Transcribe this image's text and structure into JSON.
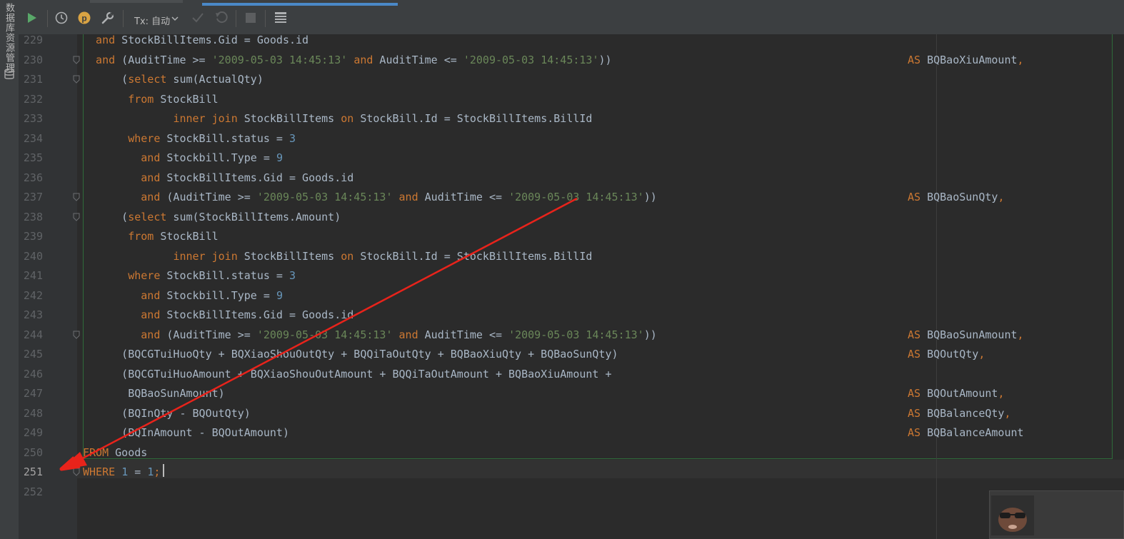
{
  "sidebar": {
    "label": "数据库资源管理"
  },
  "toolbar": {
    "tx_label": "Tx: 自动"
  },
  "icons": {
    "run": "run-icon",
    "history": "clock-icon",
    "profile": "p-icon",
    "settings": "wrench-icon",
    "commit": "check-icon",
    "rollback": "undo-icon",
    "stop": "stop-icon",
    "output": "table-icon",
    "database": "database-icon",
    "avatar": "avatar-icon"
  },
  "colors": {
    "keyword": "#cc7832",
    "string": "#6a8759",
    "number": "#6897bb",
    "text": "#a9b7c6",
    "annotation": "#e8231b"
  },
  "editor": {
    "current_line": "251",
    "lines": [
      {
        "num": "229",
        "segs": [
          {
            "t": "  and",
            "c": "kw"
          },
          {
            "t": " StockBillItems.Gid = Goods.id"
          }
        ]
      },
      {
        "num": "230",
        "segs": [
          {
            "t": "  and",
            "c": "kw"
          },
          {
            "t": " (AuditTime >= "
          },
          {
            "t": "'2009-05-03 14:45:13'",
            "c": "str"
          },
          {
            "t": " "
          },
          {
            "t": "and",
            "c": "kw"
          },
          {
            "t": " AuditTime <= "
          },
          {
            "t": "'2009-05-03 14:45:13'",
            "c": "str"
          },
          {
            "t": "))"
          }
        ],
        "as_segs": [
          {
            "t": "AS",
            "c": "kw"
          },
          {
            "t": " BQBaoXiuAmount"
          },
          {
            "t": ",",
            "c": "kw"
          }
        ]
      },
      {
        "num": "231",
        "segs": [
          {
            "t": "      ("
          },
          {
            "t": "select",
            "c": "kw"
          },
          {
            "t": " sum(ActualQty)"
          }
        ]
      },
      {
        "num": "232",
        "segs": [
          {
            "t": "       from",
            "c": "kw"
          },
          {
            "t": " StockBill"
          }
        ]
      },
      {
        "num": "233",
        "segs": [
          {
            "t": "              "
          },
          {
            "t": "inner join",
            "c": "kw"
          },
          {
            "t": " StockBillItems "
          },
          {
            "t": "on",
            "c": "kw"
          },
          {
            "t": " StockBill.Id = StockBillItems.BillId"
          }
        ]
      },
      {
        "num": "234",
        "segs": [
          {
            "t": "       where",
            "c": "kw"
          },
          {
            "t": " StockBill.status = "
          },
          {
            "t": "3",
            "c": "num"
          }
        ]
      },
      {
        "num": "235",
        "segs": [
          {
            "t": "         and",
            "c": "kw"
          },
          {
            "t": " Stockbill.Type = "
          },
          {
            "t": "9",
            "c": "num"
          }
        ]
      },
      {
        "num": "236",
        "segs": [
          {
            "t": "         and",
            "c": "kw"
          },
          {
            "t": " StockBillItems.Gid = Goods.id"
          }
        ]
      },
      {
        "num": "237",
        "segs": [
          {
            "t": "         and",
            "c": "kw"
          },
          {
            "t": " (AuditTime >= "
          },
          {
            "t": "'2009-05-03 14:45:13'",
            "c": "str"
          },
          {
            "t": " "
          },
          {
            "t": "and",
            "c": "kw"
          },
          {
            "t": " AuditTime <= "
          },
          {
            "t": "'2009-05-03 14:45:13'",
            "c": "str"
          },
          {
            "t": "))"
          }
        ],
        "as_segs": [
          {
            "t": "AS",
            "c": "kw"
          },
          {
            "t": " BQBaoSunQty"
          },
          {
            "t": ",",
            "c": "kw"
          }
        ]
      },
      {
        "num": "238",
        "segs": [
          {
            "t": "      ("
          },
          {
            "t": "select",
            "c": "kw"
          },
          {
            "t": " sum(StockBillItems.Amount)"
          }
        ]
      },
      {
        "num": "239",
        "segs": [
          {
            "t": "       from",
            "c": "kw"
          },
          {
            "t": " StockBill"
          }
        ]
      },
      {
        "num": "240",
        "segs": [
          {
            "t": "              "
          },
          {
            "t": "inner join",
            "c": "kw"
          },
          {
            "t": " StockBillItems "
          },
          {
            "t": "on",
            "c": "kw"
          },
          {
            "t": " StockBill.Id = StockBillItems.BillId"
          }
        ]
      },
      {
        "num": "241",
        "segs": [
          {
            "t": "       where",
            "c": "kw"
          },
          {
            "t": " StockBill.status = "
          },
          {
            "t": "3",
            "c": "num"
          }
        ]
      },
      {
        "num": "242",
        "segs": [
          {
            "t": "         and",
            "c": "kw"
          },
          {
            "t": " Stockbill.Type = "
          },
          {
            "t": "9",
            "c": "num"
          }
        ]
      },
      {
        "num": "243",
        "segs": [
          {
            "t": "         and",
            "c": "kw"
          },
          {
            "t": " StockBillItems.Gid = Goods.id"
          }
        ]
      },
      {
        "num": "244",
        "segs": [
          {
            "t": "         and",
            "c": "kw"
          },
          {
            "t": " (AuditTime >= "
          },
          {
            "t": "'2009-05-03 14:45:13'",
            "c": "str"
          },
          {
            "t": " "
          },
          {
            "t": "and",
            "c": "kw"
          },
          {
            "t": " AuditTime <= "
          },
          {
            "t": "'2009-05-03 14:45:13'",
            "c": "str"
          },
          {
            "t": "))"
          }
        ],
        "as_segs": [
          {
            "t": "AS",
            "c": "kw"
          },
          {
            "t": " BQBaoSunAmount"
          },
          {
            "t": ",",
            "c": "kw"
          }
        ]
      },
      {
        "num": "245",
        "segs": [
          {
            "t": "      (BQCGTuiHuoQty + BQXiaoShouOutQty + BQQiTaOutQty + BQBaoXiuQty + BQBaoSunQty)"
          }
        ],
        "as_segs": [
          {
            "t": "AS",
            "c": "kw"
          },
          {
            "t": " BQOutQty"
          },
          {
            "t": ",",
            "c": "kw"
          }
        ]
      },
      {
        "num": "246",
        "segs": [
          {
            "t": "      (BQCGTuiHuoAmount + BQXiaoShouOutAmount + BQQiTaOutAmount + BQBaoXiuAmount +"
          }
        ]
      },
      {
        "num": "247",
        "segs": [
          {
            "t": "       BQBaoSunAmount)"
          }
        ],
        "as_segs": [
          {
            "t": "AS",
            "c": "kw"
          },
          {
            "t": " BQOutAmount"
          },
          {
            "t": ",",
            "c": "kw"
          }
        ]
      },
      {
        "num": "248",
        "segs": [
          {
            "t": "      (BQInQty - BQOutQty)"
          }
        ],
        "as_segs": [
          {
            "t": "AS",
            "c": "kw"
          },
          {
            "t": " BQBalanceQty"
          },
          {
            "t": ",",
            "c": "kw"
          }
        ]
      },
      {
        "num": "249",
        "segs": [
          {
            "t": "      (BQInAmount - BQOutAmount)"
          }
        ],
        "as_segs": [
          {
            "t": "AS",
            "c": "kw"
          },
          {
            "t": " BQBalanceAmount"
          }
        ]
      },
      {
        "num": "250",
        "segs": [
          {
            "t": "FROM",
            "c": "kw"
          },
          {
            "t": " Goods"
          }
        ]
      },
      {
        "num": "251",
        "segs": [
          {
            "t": "WHERE",
            "c": "kw"
          },
          {
            "t": " "
          },
          {
            "t": "1",
            "c": "num"
          },
          {
            "t": " = "
          },
          {
            "t": "1",
            "c": "num"
          },
          {
            "t": ";",
            "c": "kw"
          }
        ]
      },
      {
        "num": "252",
        "segs": []
      }
    ]
  }
}
